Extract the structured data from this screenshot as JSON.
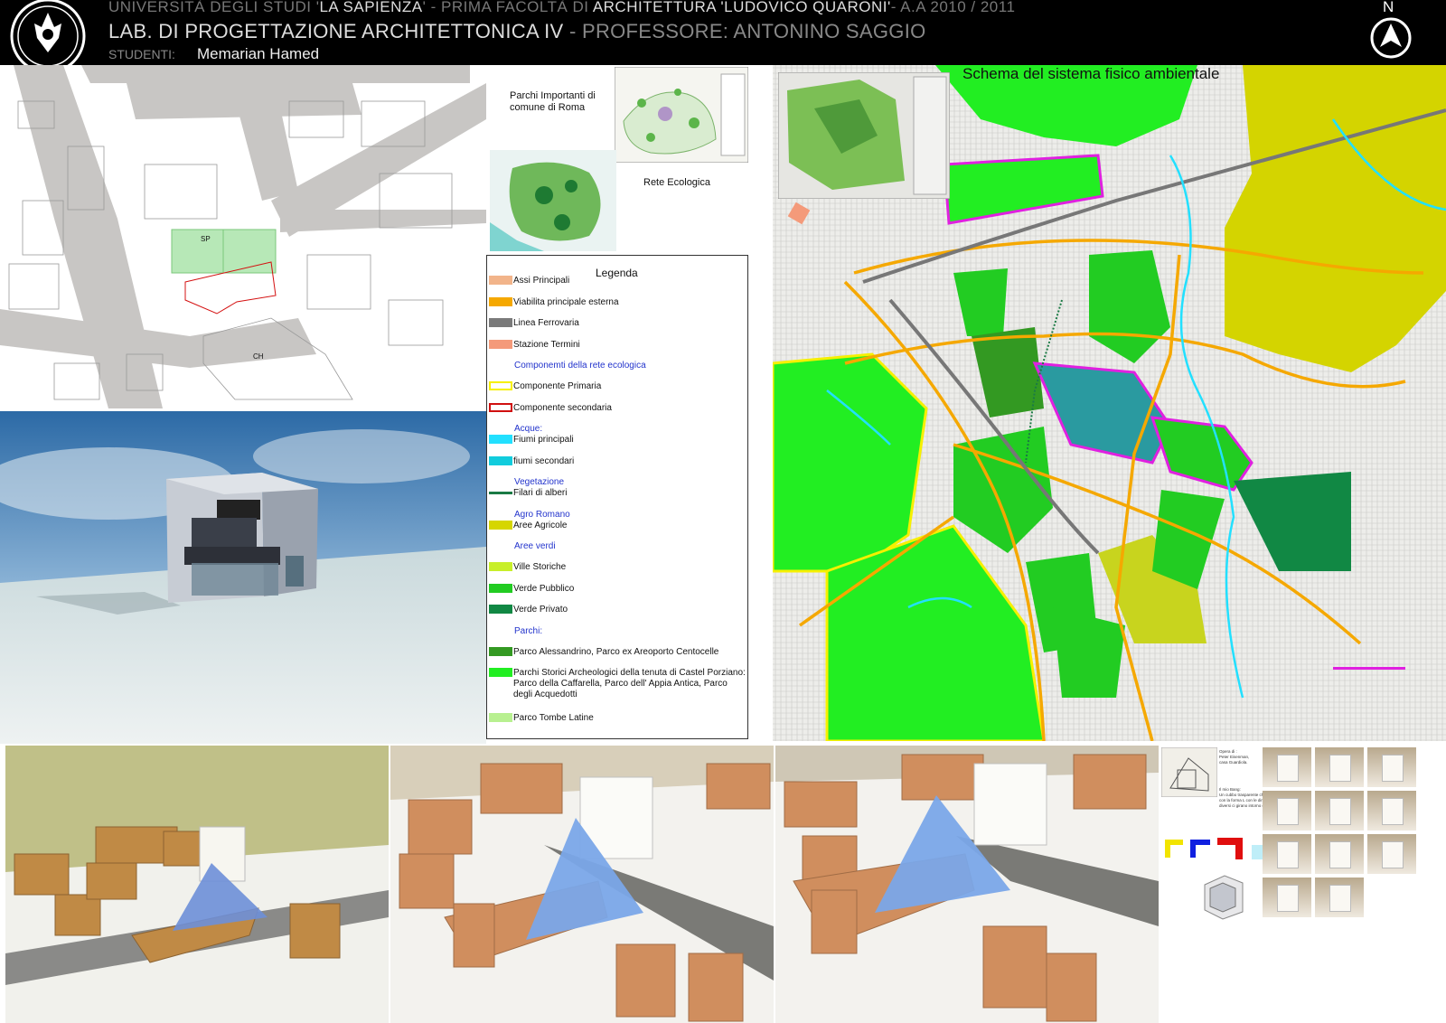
{
  "header": {
    "university_pre": "UNIVERSITÀ DEGLI STUDI '",
    "university_name": "LA SAPIENZA",
    "faculty_pre": "'  -  PRIMA FACOLTÀ DI ",
    "faculty_name": "ARCHITETTURA 'LUDOVICO QUARONI'",
    "academic_year": "- A.A 2010 / 2011",
    "course": "LAB. DI PROGETTAZIONE ARCHITETTONICA IV",
    "professor": " - PROFESSORE: ANTONINO SAGGIO",
    "students_label": "STUDENTI:",
    "student_name": "Memarian Hamed",
    "north_label": "N"
  },
  "site_plan": {
    "label_sp": "SP",
    "label_ch": "CH"
  },
  "parks": {
    "title": "Parchi Importanti di\ncomune di Roma",
    "rete_label": "Rete Ecologica"
  },
  "legend": {
    "title": "Legenda",
    "items": [
      {
        "label": "Assi Principali",
        "color": "#f2b48a",
        "style": "fill"
      },
      {
        "label": "Viabilita principale esterna",
        "color": "#f5a800",
        "style": "fill"
      },
      {
        "label": "Linea Ferrovaria",
        "color": "#7a7a7a",
        "style": "fill"
      },
      {
        "label": "Stazione Termini",
        "color": "#f49a7a",
        "style": "fill"
      },
      {
        "heading": "Componemti della rete ecologica"
      },
      {
        "label": "Componente Primaria",
        "color": "#f6f000",
        "style": "outline"
      },
      {
        "label": "Componente secondaria",
        "color": "#d01010",
        "style": "outline"
      },
      {
        "heading": "Acque:",
        "label": "Fiumi principali",
        "color": "#22e0ff",
        "style": "fill"
      },
      {
        "label": "fiumi secondari",
        "color": "#11ccdd",
        "style": "fill"
      },
      {
        "heading": "Vegetazione",
        "label": "Filari di alberi",
        "color": "#1a7a44",
        "style": "line"
      },
      {
        "heading": "Agro Romano",
        "label": "Aree Agricole",
        "color": "#d6d600",
        "style": "fill"
      },
      {
        "heading": "Aree verdi"
      },
      {
        "label": "Ville Storiche",
        "color": "#c8ef2a",
        "style": "fill"
      },
      {
        "label": "Verde Pubblico",
        "color": "#22cc22",
        "style": "fill"
      },
      {
        "label": "Verde Privato",
        "color": "#118844",
        "style": "fill"
      },
      {
        "heading": "Parchi:"
      },
      {
        "label": "Parco Alessandrino, Parco ex Areoporto Centocelle",
        "color": "#339922",
        "style": "fill"
      },
      {
        "label": "Parchi Storici Archeologici della tenuta di Castel Porziano:\nParco della Caffarella, Parco dell' Appia Antica, Parco\ndegli Acquedotti",
        "color": "#22ee22",
        "style": "fill"
      },
      {
        "label": "Parco Tombe Latine",
        "color": "#b8f090",
        "style": "fill"
      }
    ]
  },
  "map": {
    "title": "Schema del sistema fisico ambientale"
  },
  "reference": {
    "opera_text": "Opera di :\nPeter Eisenman,\ncasa Guardiola.",
    "bang_text": "Il mio Bang:\nUn cubbo trasparente che i elementi\ncon la forma L con le dimensioni\ndiversi ci girano intorno del cubbo."
  }
}
